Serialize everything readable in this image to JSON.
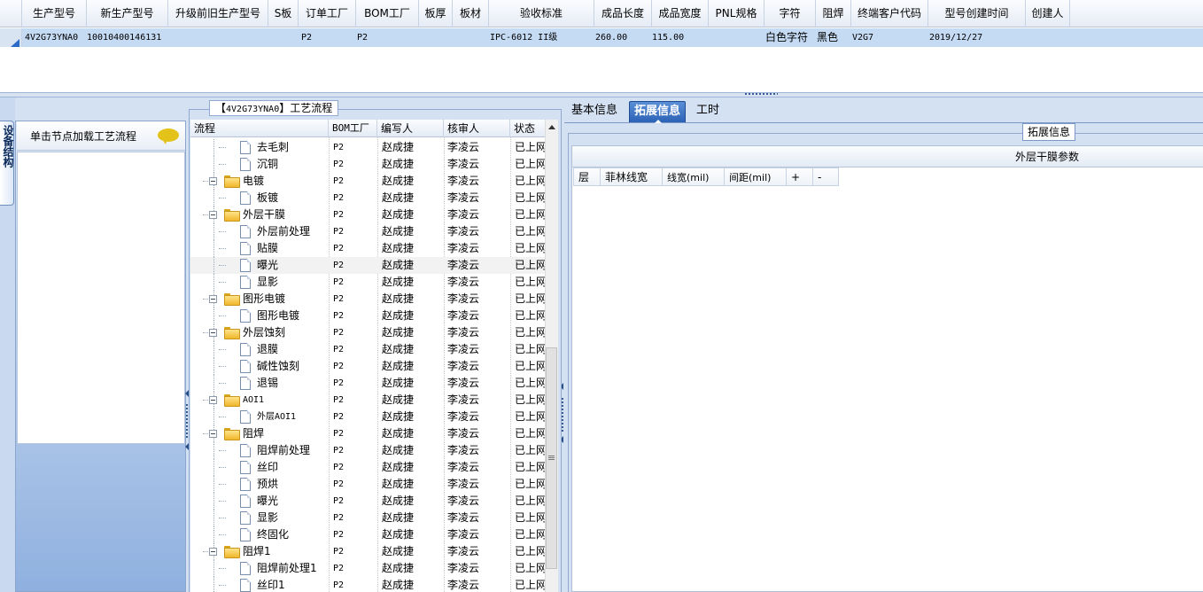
{
  "top_grid": {
    "columns": [
      "生产型号",
      "新生产型号",
      "升级前旧生产型号",
      "S板",
      "订单工厂",
      "BOM工厂",
      "板厚",
      "板材",
      "验收标准",
      "成品长度",
      "成品宽度",
      "PNL规格",
      "字符",
      "阻焊",
      "终端客户代码",
      "型号创建时间",
      "创建人"
    ],
    "row": {
      "model": "4V2G73YNA0",
      "new_model": "10010400146131",
      "old_model": "",
      "s_board": "",
      "order_factory": "P2",
      "bom_factory": "P2",
      "thickness": "",
      "material": "",
      "standard": "IPC-6012 II级",
      "length": "260.00",
      "width": "115.00",
      "pnl": "",
      "character": "白色字符",
      "solder_mask": "黑色",
      "customer_code": "V2G7",
      "created_time": "2019/12/27",
      "creator": ""
    }
  },
  "side_tab": {
    "label": "设备结构"
  },
  "node_panel": {
    "title": "单击节点加载工艺流程"
  },
  "flow": {
    "title_prefix": "【",
    "title_model": "4V2G73YNA0",
    "title_suffix": "】工艺流程",
    "columns": [
      "流程",
      "BOM工厂",
      "编写人",
      "核审人",
      "状态"
    ],
    "rows": [
      {
        "name": "去毛刺",
        "level": 2,
        "folder": false,
        "bom": "P2",
        "writer": "赵成捷",
        "reviewer": "李凌云",
        "status": "已上网"
      },
      {
        "name": "沉铜",
        "level": 2,
        "folder": false,
        "bom": "P2",
        "writer": "赵成捷",
        "reviewer": "李凌云",
        "status": "已上网"
      },
      {
        "name": "电镀",
        "level": 1,
        "folder": true,
        "bom": "P2",
        "writer": "赵成捷",
        "reviewer": "李凌云",
        "status": "已上网"
      },
      {
        "name": "板镀",
        "level": 2,
        "folder": false,
        "bom": "P2",
        "writer": "赵成捷",
        "reviewer": "李凌云",
        "status": "已上网"
      },
      {
        "name": "外层干膜",
        "level": 1,
        "folder": true,
        "bom": "P2",
        "writer": "赵成捷",
        "reviewer": "李凌云",
        "status": "已上网"
      },
      {
        "name": "外层前处理",
        "level": 2,
        "folder": false,
        "bom": "P2",
        "writer": "赵成捷",
        "reviewer": "李凌云",
        "status": "已上网"
      },
      {
        "name": "贴膜",
        "level": 2,
        "folder": false,
        "bom": "P2",
        "writer": "赵成捷",
        "reviewer": "李凌云",
        "status": "已上网"
      },
      {
        "name": "曝光",
        "level": 2,
        "folder": false,
        "bom": "P2",
        "writer": "赵成捷",
        "reviewer": "李凌云",
        "status": "已上网",
        "selected": true
      },
      {
        "name": "显影",
        "level": 2,
        "folder": false,
        "bom": "P2",
        "writer": "赵成捷",
        "reviewer": "李凌云",
        "status": "已上网"
      },
      {
        "name": "图形电镀",
        "level": 1,
        "folder": true,
        "bom": "P2",
        "writer": "赵成捷",
        "reviewer": "李凌云",
        "status": "已上网"
      },
      {
        "name": "图形电镀",
        "level": 2,
        "folder": false,
        "bom": "P2",
        "writer": "赵成捷",
        "reviewer": "李凌云",
        "status": "已上网"
      },
      {
        "name": "外层蚀刻",
        "level": 1,
        "folder": true,
        "bom": "P2",
        "writer": "赵成捷",
        "reviewer": "李凌云",
        "status": "已上网"
      },
      {
        "name": "退膜",
        "level": 2,
        "folder": false,
        "bom": "P2",
        "writer": "赵成捷",
        "reviewer": "李凌云",
        "status": "已上网"
      },
      {
        "name": "碱性蚀刻",
        "level": 2,
        "folder": false,
        "bom": "P2",
        "writer": "赵成捷",
        "reviewer": "李凌云",
        "status": "已上网"
      },
      {
        "name": "退锡",
        "level": 2,
        "folder": false,
        "bom": "P2",
        "writer": "赵成捷",
        "reviewer": "李凌云",
        "status": "已上网"
      },
      {
        "name": "AOI1",
        "level": 1,
        "folder": true,
        "bom": "P2",
        "writer": "赵成捷",
        "reviewer": "李凌云",
        "status": "已上网"
      },
      {
        "name": "外层AOI1",
        "level": 2,
        "folder": false,
        "bom": "P2",
        "writer": "赵成捷",
        "reviewer": "李凌云",
        "status": "已上网"
      },
      {
        "name": "阻焊",
        "level": 1,
        "folder": true,
        "bom": "P2",
        "writer": "赵成捷",
        "reviewer": "李凌云",
        "status": "已上网"
      },
      {
        "name": "阻焊前处理",
        "level": 2,
        "folder": false,
        "bom": "P2",
        "writer": "赵成捷",
        "reviewer": "李凌云",
        "status": "已上网"
      },
      {
        "name": "丝印",
        "level": 2,
        "folder": false,
        "bom": "P2",
        "writer": "赵成捷",
        "reviewer": "李凌云",
        "status": "已上网"
      },
      {
        "name": "预烘",
        "level": 2,
        "folder": false,
        "bom": "P2",
        "writer": "赵成捷",
        "reviewer": "李凌云",
        "status": "已上网"
      },
      {
        "name": "曝光",
        "level": 2,
        "folder": false,
        "bom": "P2",
        "writer": "赵成捷",
        "reviewer": "李凌云",
        "status": "已上网"
      },
      {
        "name": "显影",
        "level": 2,
        "folder": false,
        "bom": "P2",
        "writer": "赵成捷",
        "reviewer": "李凌云",
        "status": "已上网"
      },
      {
        "name": "终固化",
        "level": 2,
        "folder": false,
        "bom": "P2",
        "writer": "赵成捷",
        "reviewer": "李凌云",
        "status": "已上网"
      },
      {
        "name": "阻焊1",
        "level": 1,
        "folder": true,
        "bom": "P2",
        "writer": "赵成捷",
        "reviewer": "李凌云",
        "status": "已上网"
      },
      {
        "name": "阻焊前处理1",
        "level": 2,
        "folder": false,
        "bom": "P2",
        "writer": "赵成捷",
        "reviewer": "李凌云",
        "status": "已上网"
      },
      {
        "name": "丝印1",
        "level": 2,
        "folder": false,
        "bom": "P2",
        "writer": "赵成捷",
        "reviewer": "李凌云",
        "status": "已上网"
      }
    ]
  },
  "right": {
    "tabs": [
      "基本信息",
      "拓展信息",
      "工时"
    ],
    "active_tab": "拓展信息",
    "ext_box_title": "拓展信息",
    "ext_header": "外层干膜参数",
    "ext_columns": [
      "层",
      "菲林线宽",
      "线宽(mil)",
      "间距(mil)",
      "+",
      "-"
    ]
  },
  "colors": {
    "selected_row": "#c5daf3",
    "active_tab": "#2c62b6",
    "folder": "#f0b72a"
  }
}
